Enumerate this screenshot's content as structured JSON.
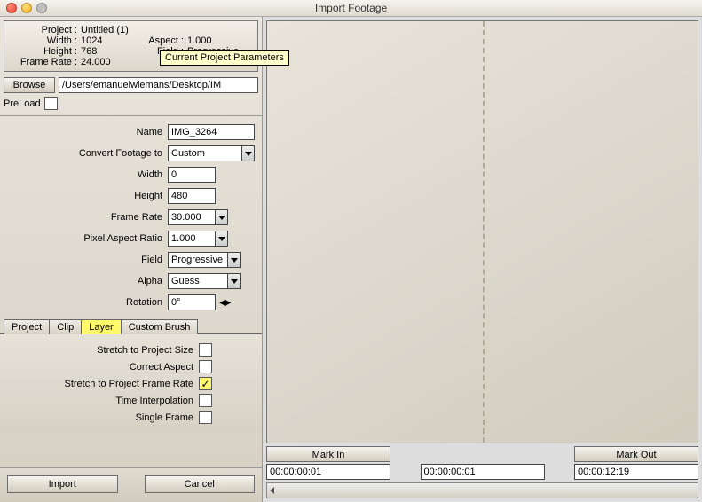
{
  "window": {
    "title": "Import Footage"
  },
  "tooltip": "Current Project Parameters",
  "project": {
    "project_lbl": "Project :",
    "project_val": "Untitled (1)",
    "width_lbl": "Width :",
    "width_val": "1024",
    "aspect_lbl": "Aspect :",
    "aspect_val": "1.000",
    "height_lbl": "Height :",
    "height_val": "768",
    "field_lbl": "Field :",
    "field_val": "Progressive",
    "frate_lbl": "Frame Rate :",
    "frate_val": "24.000"
  },
  "browse": {
    "btn": "Browse",
    "path": "/Users/emanuelwiemans/Desktop/IM",
    "preload_lbl": "PreLoad"
  },
  "params": {
    "name_lbl": "Name",
    "name_val": "IMG_3264",
    "convert_lbl": "Convert Footage to",
    "convert_val": "Custom",
    "width_lbl": "Width",
    "width_val": "0",
    "height_lbl": "Height",
    "height_val": "480",
    "frate_lbl": "Frame Rate",
    "frate_val": "30.000",
    "par_lbl": "Pixel Aspect Ratio",
    "par_val": "1.000",
    "field_lbl": "Field",
    "field_val": "Progressive",
    "alpha_lbl": "Alpha",
    "alpha_val": "Guess",
    "rot_lbl": "Rotation",
    "rot_val": "0°"
  },
  "tabs": {
    "project": "Project",
    "clip": "Clip",
    "layer": "Layer",
    "brush": "Custom Brush"
  },
  "opts": {
    "stretch_size": "Stretch to Project Size",
    "correct_aspect": "Correct Aspect",
    "stretch_frate": "Stretch to Project Frame Rate",
    "time_interp": "Time Interpolation",
    "single_frame": "Single Frame"
  },
  "buttons": {
    "import": "Import",
    "cancel": "Cancel",
    "markin": "Mark In",
    "markout": "Mark Out"
  },
  "timecode": {
    "in": "00:00:00:01",
    "mid": "00:00:00:01",
    "out": "00:00:12:19"
  }
}
